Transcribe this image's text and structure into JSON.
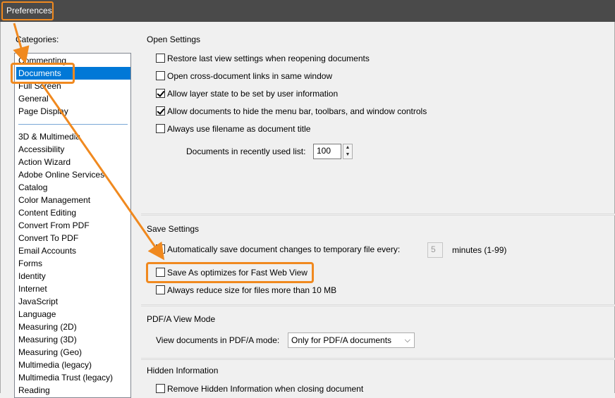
{
  "window": {
    "title": "Preferences"
  },
  "categories": {
    "label": "Categories:",
    "top": [
      "Commenting",
      "Documents",
      "Full Screen",
      "General",
      "Page Display"
    ],
    "selected": "Documents",
    "rest": [
      "3D & Multimedia",
      "Accessibility",
      "Action Wizard",
      "Adobe Online Services",
      "Catalog",
      "Color Management",
      "Content Editing",
      "Convert From PDF",
      "Convert To PDF",
      "Email Accounts",
      "Forms",
      "Identity",
      "Internet",
      "JavaScript",
      "Language",
      "Measuring (2D)",
      "Measuring (3D)",
      "Measuring (Geo)",
      "Multimedia (legacy)",
      "Multimedia Trust (legacy)",
      "Reading"
    ]
  },
  "open_settings": {
    "title": "Open Settings",
    "options": [
      {
        "label": "Restore last view settings when reopening documents",
        "checked": false
      },
      {
        "label": "Open cross-document links in same window",
        "checked": false
      },
      {
        "label": "Allow layer state to be set by user information",
        "checked": true
      },
      {
        "label": "Allow documents to hide the menu bar, toolbars, and window controls",
        "checked": true
      },
      {
        "label": "Always use filename as document title",
        "checked": false
      }
    ],
    "recent_label": "Documents in recently used list:",
    "recent_value": "100"
  },
  "save_settings": {
    "title": "Save Settings",
    "autosave_label": "Automatically save document changes to temporary file every:",
    "autosave_value": "5",
    "autosave_units": "minutes (1-99)",
    "fast_web_label": "Save As optimizes for Fast Web View",
    "reduce_label": "Always reduce size for files more than 10 MB"
  },
  "pdfa": {
    "title": "PDF/A View Mode",
    "mode_label": "View documents in PDF/A mode:",
    "mode_value": "Only for PDF/A documents"
  },
  "hidden_info": {
    "title": "Hidden Information",
    "remove_label": "Remove Hidden Information when closing document"
  },
  "colors": {
    "highlight": "#f0891f",
    "selection": "#0078d7"
  }
}
